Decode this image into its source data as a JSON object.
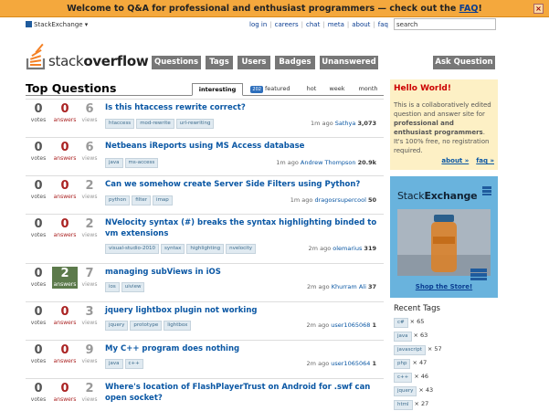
{
  "notify": {
    "text": "Welcome to Q&A for professional and enthusiast programmers — check out the ",
    "faq": "FAQ",
    "end": "!",
    "close": "×"
  },
  "brand": {
    "network": "StackExchange ▾"
  },
  "toplinks": [
    "log in",
    "careers",
    "chat",
    "meta",
    "about",
    "faq"
  ],
  "search": {
    "value": "search"
  },
  "logo": {
    "light": "stack",
    "bold": "overflow"
  },
  "nav": [
    "Questions",
    "Tags",
    "Users",
    "Badges",
    "Unanswered"
  ],
  "ask": "Ask Question",
  "heading": "Top Questions",
  "tabs": {
    "interesting": "interesting",
    "featured_count": "202",
    "featured": "featured",
    "hot": "hot",
    "week": "week",
    "month": "month"
  },
  "labels": {
    "votes": "votes",
    "answers": "answers",
    "views": "views"
  },
  "questions": [
    {
      "votes": "0",
      "answers": "0",
      "views": "6",
      "title": "Is this htaccess rewrite correct?",
      "tags": [
        "htaccess",
        "mod-rewrite",
        "url-rewriting"
      ],
      "time": "1m ago",
      "user": "Sathya",
      "rep": "3,073"
    },
    {
      "votes": "0",
      "answers": "0",
      "views": "6",
      "title": "Netbeans iReports using MS Access database",
      "tags": [
        "java",
        "ms-access"
      ],
      "time": "1m ago",
      "user": "Andrew Thompson",
      "rep": "20.9k"
    },
    {
      "votes": "0",
      "answers": "0",
      "views": "2",
      "title": "Can we somehow create Server Side Filters using Python?",
      "tags": [
        "python",
        "filter",
        "imap"
      ],
      "time": "1m ago",
      "user": "dragosrsupercool",
      "rep": "50"
    },
    {
      "votes": "0",
      "answers": "0",
      "views": "2",
      "title": "NVelocity syntax (#) breaks the syntax highlighting binded to vm extensions",
      "tags": [
        "visual-studio-2010",
        "syntax",
        "highlighting",
        "nvelocity"
      ],
      "time": "2m ago",
      "user": "olemarius",
      "rep": "319"
    },
    {
      "votes": "0",
      "answers": "2",
      "views": "7",
      "title": "managing subViews in iOS",
      "tags": [
        "ios",
        "uiview"
      ],
      "time": "2m ago",
      "user": "Khurram Ali",
      "rep": "37"
    },
    {
      "votes": "0",
      "answers": "0",
      "views": "3",
      "title": "jquery lightbox plugin not working",
      "tags": [
        "jquery",
        "prototype",
        "lightbox"
      ],
      "time": "2m ago",
      "user": "user1065068",
      "rep": "1"
    },
    {
      "votes": "0",
      "answers": "0",
      "views": "9",
      "title": "My C++ program does nothing",
      "tags": [
        "java",
        "c++"
      ],
      "time": "2m ago",
      "user": "user1065064",
      "rep": "1"
    },
    {
      "votes": "0",
      "answers": "0",
      "views": "2",
      "title": "Where's location of FlashPlayerTrust on Android for .swf can open socket?",
      "tags": [],
      "time": "",
      "user": "",
      "rep": ""
    }
  ],
  "hello": {
    "title": "Hello World!",
    "pre": "This is a collaboratively edited question and answer site for ",
    "bold": "professional and enthusiast programmers",
    "post": ". It's 100% free, no registration required.",
    "about": "about »",
    "faq": "faq »"
  },
  "ad": {
    "logo_light": "Stack",
    "logo_bold": "Exchange",
    "shop": "Shop the Store!"
  },
  "recent_tags": {
    "title": "Recent Tags",
    "items": [
      {
        "name": "c#",
        "count": "× 65"
      },
      {
        "name": "java",
        "count": "× 63"
      },
      {
        "name": "javascript",
        "count": "× 57"
      },
      {
        "name": "php",
        "count": "× 47"
      },
      {
        "name": "c++",
        "count": "× 46"
      },
      {
        "name": "jquery",
        "count": "× 43"
      },
      {
        "name": "html",
        "count": "× 27"
      }
    ]
  },
  "colors": {
    "notify_bar": "#f4a83d",
    "link": "#0a57a4",
    "answers_red": "#aa2222",
    "accepted_green": "#5c7a4b",
    "ad_blue": "#69b3dd"
  }
}
